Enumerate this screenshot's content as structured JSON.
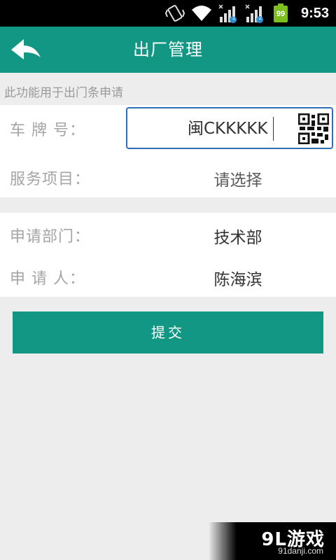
{
  "status_bar": {
    "time": "9:53",
    "battery": "99",
    "sim1_badge": "1",
    "sim2_badge": "2",
    "icons": [
      "vibrate-icon",
      "wifi-icon",
      "signal-icon",
      "signal-icon",
      "battery-icon"
    ]
  },
  "header": {
    "title": "出厂管理",
    "back_icon": "back-arrow-icon"
  },
  "hint": "此功能用于出门条申请",
  "form": {
    "plate_label": "车 牌 号：",
    "plate_value": "闽CKKKKK",
    "service_label": "服务项目：",
    "service_value": "请选择",
    "dept_label": "申请部门：",
    "dept_value": "技术部",
    "applicant_label": "申 请 人：",
    "applicant_value": "陈海滨"
  },
  "submit_label": "提交",
  "watermark": {
    "logo": "9L游戏",
    "url": "91danji.com"
  },
  "colors": {
    "accent": "#139785",
    "input_border": "#2f6fb8",
    "background": "#ededed"
  }
}
